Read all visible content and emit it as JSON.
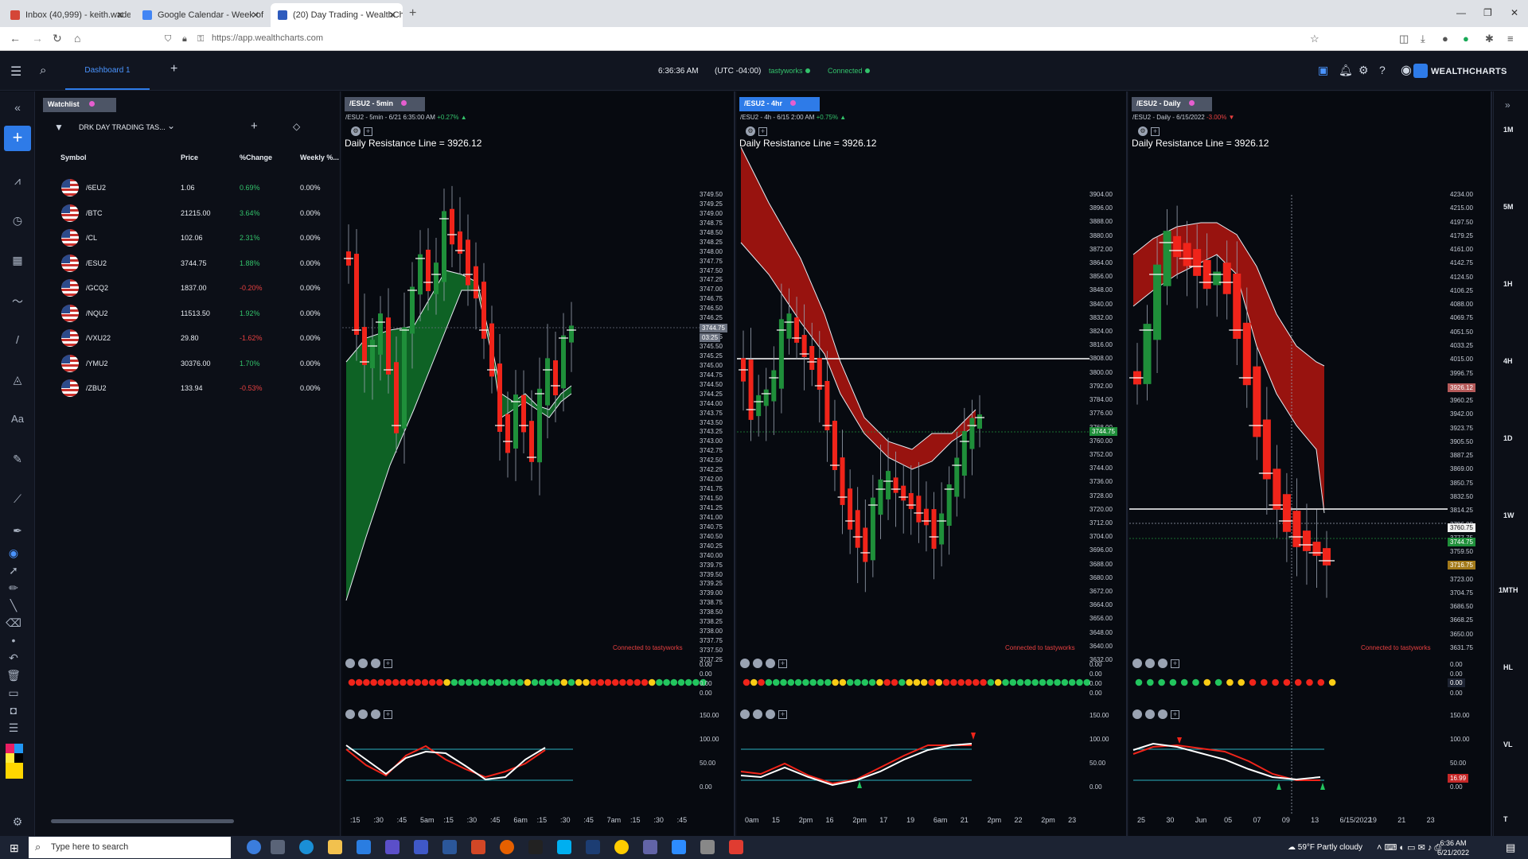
{
  "browser": {
    "tabs": [
      {
        "label": "Inbox (40,999) - keith.wade.dbs",
        "active": false,
        "color": "#d44638"
      },
      {
        "label": "Google Calendar - Week of Jun",
        "active": false,
        "color": "#4285f4"
      },
      {
        "label": "(20) Day Trading - WealthCharts",
        "active": true,
        "color": "#2e5bbd"
      }
    ],
    "url": "https://app.wealthcharts.com"
  },
  "header": {
    "dashboard_tab": "Dashboard 1",
    "time": "6:36:36 AM",
    "timezone": "(UTC -04:00)",
    "broker": "tastyworks",
    "connection": "Connected",
    "brand": "WEALTHCHARTS"
  },
  "watchlist": {
    "tab_label": "Watchlist",
    "selected_list": "DRK DAY TRADING TAS...",
    "columns": [
      "Symbol",
      "Price",
      "%Change",
      "Weekly %..."
    ],
    "rows": [
      {
        "symbol": "/6EU2",
        "price": "1.06",
        "change": "0.69%",
        "weekly": "0.00%",
        "up": true
      },
      {
        "symbol": "/BTC",
        "price": "21215.00",
        "change": "3.64%",
        "weekly": "0.00%",
        "up": true
      },
      {
        "symbol": "/CL",
        "price": "102.06",
        "change": "2.31%",
        "weekly": "0.00%",
        "up": true
      },
      {
        "symbol": "/ESU2",
        "price": "3744.75",
        "change": "1.88%",
        "weekly": "0.00%",
        "up": true
      },
      {
        "symbol": "/GCQ2",
        "price": "1837.00",
        "change": "-0.20%",
        "weekly": "0.00%",
        "up": false
      },
      {
        "symbol": "/NQU2",
        "price": "11513.50",
        "change": "1.92%",
        "weekly": "0.00%",
        "up": true
      },
      {
        "symbol": "/VXU22",
        "price": "29.80",
        "change": "-1.62%",
        "weekly": "0.00%",
        "up": false
      },
      {
        "symbol": "/YMU2",
        "price": "30376.00",
        "change": "1.70%",
        "weekly": "0.00%",
        "up": true
      },
      {
        "symbol": "/ZBU2",
        "price": "133.94",
        "change": "-0.53%",
        "weekly": "0.00%",
        "up": false
      }
    ]
  },
  "panels": [
    {
      "tab": "/ESU2 - 5min",
      "info_main": "/ESU2 - 5min - 6/21 6:35:00 AM",
      "info_change": "+0.27%",
      "info_up": true,
      "annotation": "Daily Resistance Line = 3926.12",
      "connected": "Connected to tastyworks",
      "y_labels": [
        "3749.50",
        "3749.25",
        "3749.00",
        "3748.75",
        "3748.50",
        "3748.25",
        "3748.00",
        "3747.75",
        "3747.50",
        "3747.25",
        "3747.00",
        "3746.75",
        "3746.50",
        "3746.25",
        "3746.00",
        "3745.75",
        "3745.50",
        "3745.25",
        "3745.00",
        "3744.75",
        "3744.50",
        "3744.25",
        "3744.00",
        "3743.75",
        "3743.50",
        "3743.25",
        "3743.00",
        "3742.75",
        "3742.50",
        "3742.25",
        "3742.00",
        "3741.75",
        "3741.50",
        "3741.25",
        "3741.00",
        "3740.75",
        "3740.50",
        "3740.25",
        "3740.00",
        "3739.75",
        "3739.50",
        "3739.25",
        "3739.00",
        "3738.75",
        "3738.50",
        "3738.25",
        "3738.00",
        "3737.75",
        "3737.50",
        "3737.25"
      ],
      "price_tag": "3744.75",
      "timer_tag": "03:25",
      "ind_labels": [
        "0.00",
        "0.00",
        "0.00",
        "0.00"
      ],
      "osc_labels": [
        "150.00",
        "100.00",
        "50.00",
        "0.00"
      ],
      "x_labels": [
        ":15",
        ":30",
        ":45",
        "5am",
        ":15",
        ":30",
        ":45",
        "6am",
        ":15",
        ":30",
        ":45",
        "7am",
        ":15",
        ":30",
        ":45"
      ],
      "dots": [
        "r",
        "r",
        "r",
        "r",
        "r",
        "r",
        "r",
        "r",
        "r",
        "r",
        "r",
        "r",
        "r",
        "y",
        "g",
        "g",
        "g",
        "g",
        "g",
        "g",
        "g",
        "g",
        "g",
        "g",
        "y",
        "g",
        "g",
        "g",
        "g",
        "y",
        "g",
        "y",
        "y",
        "r",
        "r",
        "r",
        "r",
        "r",
        "r",
        "r",
        "r",
        "y",
        "g",
        "g",
        "g",
        "g",
        "g",
        "g",
        "g"
      ]
    },
    {
      "tab": "/ESU2 - 4hr",
      "info_main": "/ESU2 - 4h - 6/15 2:00 AM",
      "info_change": "+0.75%",
      "info_up": true,
      "annotation": "Daily Resistance Line = 3926.12",
      "connected": "Connected to tastyworks",
      "y_labels": [
        "3904.00",
        "3896.00",
        "3888.00",
        "3880.00",
        "3872.00",
        "3864.00",
        "3856.00",
        "3848.00",
        "3840.00",
        "3832.00",
        "3824.00",
        "3816.00",
        "3808.00",
        "3800.00",
        "3792.00",
        "3784.00",
        "3776.00",
        "3768.00",
        "3760.00",
        "3752.00",
        "3744.00",
        "3736.00",
        "3728.00",
        "3720.00",
        "3712.00",
        "3704.00",
        "3696.00",
        "3688.00",
        "3680.00",
        "3672.00",
        "3664.00",
        "3656.00",
        "3648.00",
        "3640.00",
        "3632.00"
      ],
      "price_tag": "3744.75",
      "ind_labels": [
        "0.00",
        "0.00",
        "0.00",
        "0.00"
      ],
      "osc_labels": [
        "150.00",
        "100.00",
        "50.00",
        "0.00"
      ],
      "x_labels": [
        "0am",
        "15",
        "2pm",
        "16",
        "2pm",
        "17",
        "19",
        "6am",
        "21",
        "2pm",
        "22",
        "2pm",
        "23"
      ],
      "dots": [
        "r",
        "y",
        "r",
        "g",
        "g",
        "g",
        "g",
        "g",
        "g",
        "g",
        "g",
        "g",
        "y",
        "y",
        "g",
        "g",
        "g",
        "g",
        "y",
        "r",
        "r",
        "g",
        "y",
        "y",
        "y",
        "r",
        "y",
        "r",
        "r",
        "r",
        "r",
        "r",
        "r",
        "g",
        "y",
        "g",
        "g",
        "g",
        "g",
        "g",
        "g",
        "g",
        "g",
        "g",
        "g",
        "g",
        "g"
      ]
    },
    {
      "tab": "/ESU2 - Daily",
      "info_main": "/ESU2 - Daily - 6/15/2022",
      "info_change": "-3.00%",
      "info_up": false,
      "annotation": "Daily Resistance Line = 3926.12",
      "connected": "Connected to tastyworks",
      "y_labels": [
        "4234.00",
        "4215.00",
        "4197.50",
        "4179.25",
        "4161.00",
        "4142.75",
        "4124.50",
        "4106.25",
        "4088.00",
        "4069.75",
        "4051.50",
        "4033.25",
        "4015.00",
        "3996.75",
        "3978.50",
        "3960.25",
        "3942.00",
        "3923.75",
        "3905.50",
        "3887.25",
        "3869.00",
        "3850.75",
        "3832.50",
        "3814.25",
        "3796.00",
        "3777.75",
        "3759.50",
        "3741.25",
        "3723.00",
        "3704.75",
        "3686.50",
        "3668.25",
        "3650.00",
        "3631.75"
      ],
      "tag_resistance": "3926.12",
      "tag_cursor": "3760.75",
      "tag_price": "3744.75",
      "tag_low": "3716.75",
      "tag_osc": "16.99",
      "ind_value": "0.00",
      "ind_labels": [
        "0.00",
        "0.00",
        "0.00",
        "0.00"
      ],
      "osc_labels": [
        "150.00",
        "100.00",
        "50.00",
        "0.00"
      ],
      "x_labels": [
        "25",
        "30",
        "Jun",
        "05",
        "07",
        "09",
        "13",
        "6/15/2022",
        "19",
        "21",
        "23"
      ],
      "dots": [
        "g",
        "g",
        "g",
        "g",
        "g",
        "g",
        "y",
        "g",
        "y",
        "y",
        "r",
        "r",
        "r",
        "r",
        "r",
        "r",
        "r",
        "y"
      ]
    }
  ],
  "timeframes": [
    "1M",
    "5M",
    "1H",
    "4H",
    "1D",
    "1W",
    "1MTH",
    "HL",
    "VL",
    "T"
  ],
  "taskbar": {
    "search_placeholder": "Type here to search",
    "weather": "59°F  Partly cloudy",
    "time": "6:36 AM",
    "date": "6/21/2022"
  }
}
